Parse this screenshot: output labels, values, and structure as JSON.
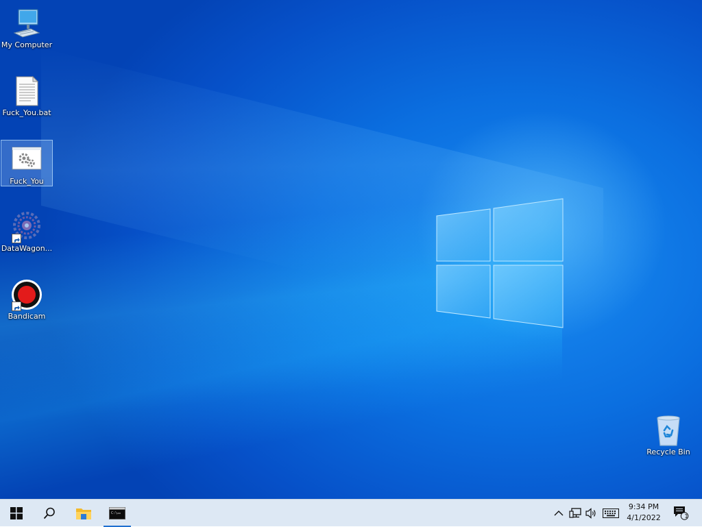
{
  "desktop": {
    "icons": [
      {
        "label": "My Computer",
        "icon": "computer-icon"
      },
      {
        "label": "Fuck_You.bat",
        "icon": "batch-file-icon"
      },
      {
        "label": "Fuck_You",
        "icon": "application-icon",
        "selected": true
      },
      {
        "label": "DataWagon...",
        "icon": "datawagon-icon",
        "shortcut": true
      },
      {
        "label": "Bandicam",
        "icon": "bandicam-icon",
        "shortcut": true
      }
    ],
    "recycle_bin": {
      "label": "Recycle Bin",
      "icon": "recycle-bin-icon"
    }
  },
  "taskbar": {
    "items": [
      {
        "name": "start",
        "icon": "windows-start-icon"
      },
      {
        "name": "search",
        "icon": "search-icon"
      },
      {
        "name": "file-explorer",
        "icon": "folder-icon"
      },
      {
        "name": "command-prompt",
        "icon": "terminal-icon",
        "active": true
      }
    ],
    "tray": {
      "icons": [
        "chevron-up-icon",
        "network-icon",
        "volume-icon",
        "keyboard-icon"
      ],
      "time": "9:34 PM",
      "date": "4/1/2022",
      "notifications": {
        "icon": "action-center-icon",
        "count": "1"
      }
    }
  },
  "colors": {
    "taskbar_bg": "#dde8f4",
    "accent": "#1f6fd0",
    "desktop_blue": "#0b6fe0"
  }
}
